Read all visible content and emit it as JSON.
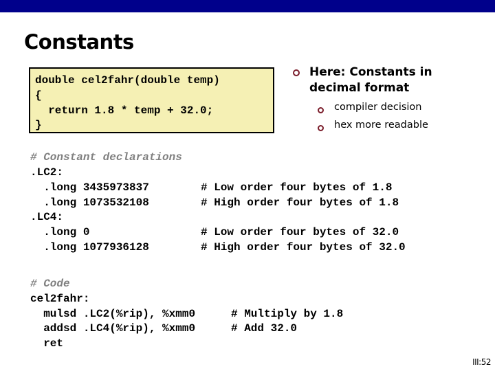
{
  "slide": {
    "title": "Constants",
    "page_number": "III:52"
  },
  "c_code": {
    "lines": [
      "double cel2fahr(double temp)",
      "{",
      "  return 1.8 * temp + 32.0;",
      "}"
    ]
  },
  "bullets": {
    "main": "Here: Constants in decimal format",
    "sub": [
      "compiler decision",
      "hex more readable"
    ]
  },
  "asm": {
    "decl_comment": "# Constant declarations",
    "decl_lines": [
      {
        "code": ".LC2:",
        "comment": ""
      },
      {
        "code": "  .long 3435973837",
        "comment": "# Low order four bytes of 1.8"
      },
      {
        "code": "  .long 1073532108",
        "comment": "# High order four bytes of 1.8"
      },
      {
        "code": ".LC4:",
        "comment": ""
      },
      {
        "code": "  .long 0",
        "comment": "# Low order four bytes of 32.0"
      },
      {
        "code": "  .long 1077936128",
        "comment": "# High order four bytes of 32.0"
      }
    ],
    "code_comment": "# Code",
    "code_lines": [
      {
        "code": "cel2fahr:",
        "comment": ""
      },
      {
        "code": "  mulsd .LC2(%rip), %xmm0",
        "comment": "# Multiply by 1.8"
      },
      {
        "code": "  addsd .LC4(%rip), %xmm0",
        "comment": "# Add 32.0"
      },
      {
        "code": "  ret",
        "comment": ""
      }
    ]
  },
  "colors": {
    "top_bar": "#00008b",
    "code_box_bg": "#f5f0b4",
    "bullet": "#7a1c2a",
    "comment": "#808080"
  }
}
